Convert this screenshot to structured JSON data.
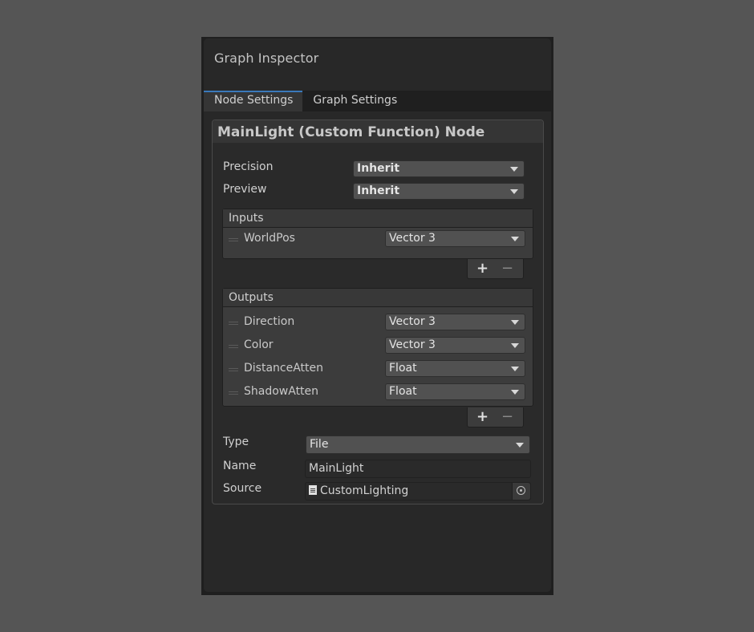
{
  "window": {
    "title": "Graph Inspector"
  },
  "tabs": [
    {
      "label": "Node Settings",
      "active": true
    },
    {
      "label": "Graph Settings",
      "active": false
    }
  ],
  "node": {
    "title": "MainLight (Custom Function) Node",
    "precision": {
      "label": "Precision",
      "value": "Inherit"
    },
    "preview": {
      "label": "Preview",
      "value": "Inherit"
    },
    "inputs": {
      "header": "Inputs",
      "rows": [
        {
          "name": "WorldPos",
          "type": "Vector 3"
        }
      ]
    },
    "outputs": {
      "header": "Outputs",
      "rows": [
        {
          "name": "Direction",
          "type": "Vector 3"
        },
        {
          "name": "Color",
          "type": "Vector 3"
        },
        {
          "name": "DistanceAtten",
          "type": "Float"
        },
        {
          "name": "ShadowAtten",
          "type": "Float"
        }
      ]
    },
    "add_glyph": "+",
    "remove_glyph": "−",
    "type_field": {
      "label": "Type",
      "value": "File"
    },
    "name_field": {
      "label": "Name",
      "value": "MainLight"
    },
    "source_field": {
      "label": "Source",
      "value": "CustomLighting",
      "icon": "file-icon",
      "picker_icon": "object-picker-icon"
    }
  },
  "colors": {
    "background": "#555555",
    "panel": "#282828",
    "tab_accent": "#3a79bb",
    "dropdown": "#515151"
  }
}
